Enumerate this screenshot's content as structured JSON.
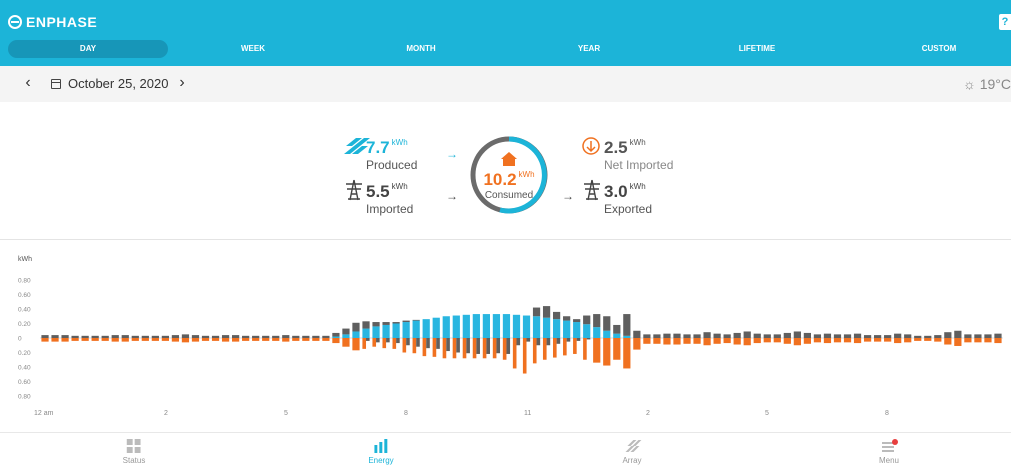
{
  "app": {
    "brand": "ENPHASE",
    "help_label": "?"
  },
  "tabs": [
    {
      "label": "DAY",
      "active": true
    },
    {
      "label": "WEEK",
      "active": false
    },
    {
      "label": "MONTH",
      "active": false
    },
    {
      "label": "YEAR",
      "active": false
    },
    {
      "label": "LIFETIME",
      "active": false
    },
    {
      "label": "CUSTOM",
      "active": false
    }
  ],
  "datebar": {
    "prev_icon": "chevron-left-icon",
    "next_icon": "chevron-right-icon",
    "date": "October 25, 2020",
    "weather": "☼ 19°C"
  },
  "summary": {
    "produced": {
      "value": "7.7",
      "unit": "kWh",
      "label": "Produced"
    },
    "imported": {
      "value": "5.5",
      "unit": "kWh",
      "label": "Imported"
    },
    "consumed": {
      "value": "10.2",
      "unit": "kWh",
      "label": "Consumed"
    },
    "net_imported": {
      "value": "2.5",
      "unit": "kWh",
      "label": "Net Imported"
    },
    "exported": {
      "value": "3.0",
      "unit": "kWh",
      "label": "Exported"
    }
  },
  "colors": {
    "primary": "#1cb4d8",
    "produced": "#29b6e0",
    "consumed": "#f07120",
    "grid": "#666666"
  },
  "chart_data": {
    "type": "bar",
    "ylabel": "kWh",
    "yticks": [
      "0.80",
      "0.60",
      "0.40",
      "0.20",
      "0",
      "0.20",
      "0.40",
      "0.60",
      "0.80"
    ],
    "ylim": [
      -0.8,
      0.8
    ],
    "xticks": [
      "12 am",
      "2",
      "5",
      "8",
      "11",
      "2",
      "5",
      "8"
    ],
    "series": [
      {
        "name": "produced",
        "values": [
          0,
          0,
          0,
          0,
          0,
          0,
          0,
          0,
          0,
          0,
          0,
          0,
          0,
          0,
          0,
          0,
          0,
          0,
          0,
          0,
          0,
          0,
          0,
          0,
          0,
          0,
          0,
          0,
          0,
          0.02,
          0.05,
          0.09,
          0.13,
          0.16,
          0.18,
          0.2,
          0.22,
          0.24,
          0.26,
          0.28,
          0.3,
          0.31,
          0.32,
          0.33,
          0.33,
          0.33,
          0.33,
          0.32,
          0.31,
          0.3,
          0.28,
          0.26,
          0.24,
          0.22,
          0.19,
          0.15,
          0.1,
          0.06,
          0.03,
          0,
          0,
          0,
          0,
          0,
          0,
          0,
          0,
          0,
          0,
          0,
          0,
          0,
          0,
          0,
          0,
          0,
          0,
          0,
          0,
          0,
          0,
          0,
          0,
          0,
          0,
          0,
          0,
          0,
          0,
          0,
          0,
          0,
          0,
          0,
          0,
          0
        ]
      },
      {
        "name": "grid",
        "values": [
          0.04,
          0.04,
          0.04,
          0.03,
          0.03,
          0.03,
          0.03,
          0.04,
          0.04,
          0.03,
          0.03,
          0.03,
          0.03,
          0.04,
          0.05,
          0.04,
          0.03,
          0.03,
          0.04,
          0.04,
          0.03,
          0.03,
          0.03,
          0.03,
          0.04,
          0.03,
          0.03,
          0.03,
          0.03,
          0.05,
          0.08,
          0.12,
          0.1,
          0.06,
          0.04,
          0.02,
          0.02,
          0.01,
          0,
          0,
          0,
          0,
          0,
          0,
          0,
          0,
          0,
          0,
          0,
          0.12,
          0.16,
          0.1,
          0.06,
          0.04,
          0.12,
          0.18,
          0.2,
          0.12,
          0.3,
          0.1,
          0.05,
          0.05,
          0.06,
          0.06,
          0.05,
          0.05,
          0.08,
          0.06,
          0.05,
          0.07,
          0.09,
          0.06,
          0.05,
          0.05,
          0.07,
          0.09,
          0.07,
          0.05,
          0.06,
          0.05,
          0.05,
          0.06,
          0.04,
          0.04,
          0.04,
          0.06,
          0.05,
          0.03,
          0.03,
          0.04,
          0.08,
          0.1,
          0.05,
          0.05,
          0.05,
          0.06
        ]
      },
      {
        "name": "consumed",
        "values": [
          0.05,
          0.05,
          0.05,
          0.04,
          0.04,
          0.04,
          0.04,
          0.05,
          0.05,
          0.04,
          0.04,
          0.04,
          0.04,
          0.05,
          0.06,
          0.05,
          0.04,
          0.04,
          0.05,
          0.05,
          0.04,
          0.04,
          0.04,
          0.04,
          0.05,
          0.04,
          0.04,
          0.04,
          0.04,
          0.07,
          0.12,
          0.17,
          0.15,
          0.12,
          0.14,
          0.15,
          0.2,
          0.21,
          0.25,
          0.26,
          0.28,
          0.28,
          0.28,
          0.28,
          0.28,
          0.28,
          0.3,
          0.42,
          0.49,
          0.35,
          0.3,
          0.27,
          0.24,
          0.22,
          0.3,
          0.34,
          0.38,
          0.3,
          0.42,
          0.16,
          0.08,
          0.08,
          0.09,
          0.09,
          0.08,
          0.08,
          0.1,
          0.08,
          0.07,
          0.09,
          0.1,
          0.07,
          0.06,
          0.06,
          0.08,
          0.1,
          0.08,
          0.06,
          0.07,
          0.06,
          0.06,
          0.07,
          0.05,
          0.05,
          0.05,
          0.07,
          0.06,
          0.04,
          0.04,
          0.05,
          0.09,
          0.11,
          0.06,
          0.06,
          0.06,
          0.07
        ]
      },
      {
        "name": "exported",
        "values": [
          0,
          0,
          0,
          0,
          0,
          0,
          0,
          0,
          0,
          0,
          0,
          0,
          0,
          0,
          0,
          0,
          0,
          0,
          0,
          0,
          0,
          0,
          0,
          0,
          0,
          0,
          0,
          0,
          0,
          0,
          0,
          0,
          0.04,
          0.06,
          0.06,
          0.07,
          0.1,
          0.12,
          0.14,
          0.15,
          0.18,
          0.2,
          0.21,
          0.22,
          0.22,
          0.21,
          0.22,
          0.1,
          0.05,
          0.1,
          0.1,
          0.08,
          0.05,
          0.04,
          0.02,
          0,
          0,
          0,
          0,
          0,
          0,
          0,
          0,
          0,
          0,
          0,
          0,
          0,
          0,
          0,
          0,
          0,
          0,
          0,
          0,
          0,
          0,
          0,
          0,
          0,
          0,
          0,
          0,
          0,
          0,
          0,
          0,
          0,
          0,
          0,
          0,
          0,
          0,
          0,
          0,
          0
        ]
      }
    ]
  },
  "bottomnav": [
    {
      "label": "Status",
      "icon": "status-grid-icon",
      "active": false
    },
    {
      "label": "Energy",
      "icon": "energy-bars-icon",
      "active": true
    },
    {
      "label": "Array",
      "icon": "array-panels-icon",
      "active": false
    },
    {
      "label": "Menu",
      "icon": "menu-icon",
      "active": false,
      "badge": true
    }
  ]
}
